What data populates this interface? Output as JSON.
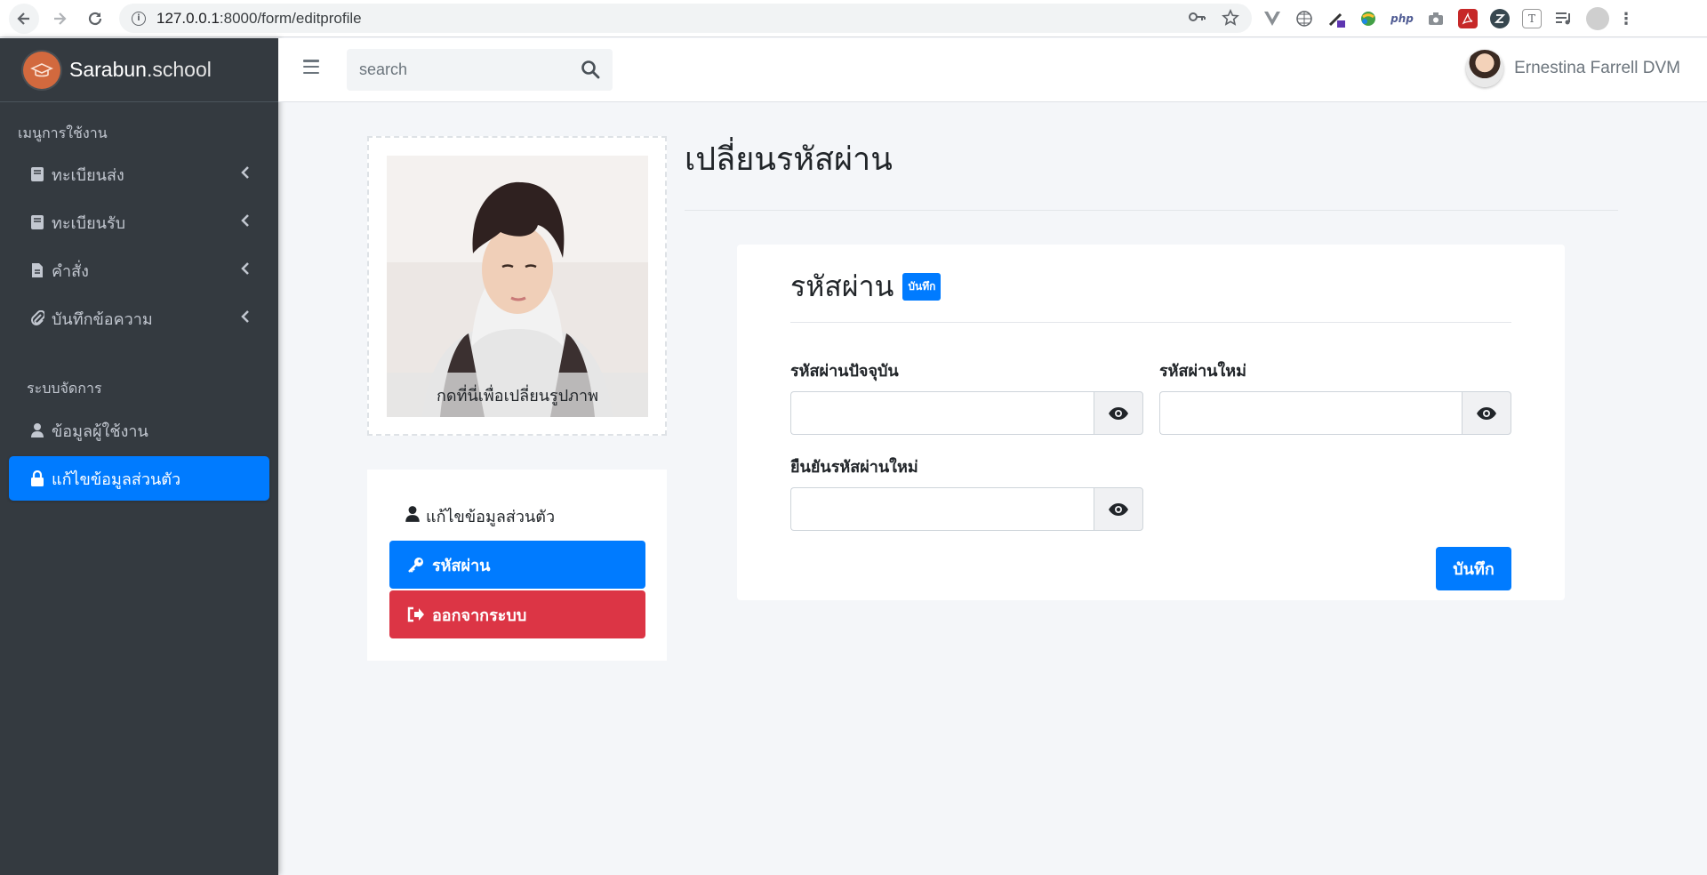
{
  "browser": {
    "url_host": "127.0.0.1",
    "url_rest": ":8000/form/editprofile",
    "icons": [
      "back-icon",
      "forward-icon",
      "reload-icon",
      "key-icon",
      "star-icon"
    ]
  },
  "brand": {
    "name_bold": "Sarabun",
    "name_rest": ".school",
    "logo_icon": "graduation-cap-icon",
    "logo_color": "#d2693e"
  },
  "sidebar": {
    "section1_header": "เมนูการใช้งาน",
    "section1_items": [
      {
        "label": "ทะเบียนส่ง",
        "icon": "book-icon"
      },
      {
        "label": "ทะเบียนรับ",
        "icon": "book-icon"
      },
      {
        "label": "คำสั่ง",
        "icon": "file-icon"
      },
      {
        "label": "บันทึกข้อความ",
        "icon": "paperclip-icon"
      }
    ],
    "section2_header": "ระบบจัดการ",
    "section2_items": [
      {
        "label": "ข้อมูลผู้ใช้งาน",
        "icon": "user-icon"
      },
      {
        "label": "แก้ไขข้อมูลส่วนตัว",
        "icon": "lock-icon",
        "active": true
      }
    ],
    "active_color": "#007bff"
  },
  "topbar": {
    "search_placeholder": "search",
    "user_name": "Ernestina Farrell DVM"
  },
  "profile": {
    "change_photo_caption": "กดที่นี่เพื่อเปลี่ยนรูปภาพ",
    "menu_title": "แก้ไขข้อมูลส่วนตัว",
    "password_button": "รหัสผ่าน",
    "logout_button": "ออกจากระบบ",
    "danger_color": "#dc3545"
  },
  "page": {
    "title": "เปลี่ยนรหัสผ่าน"
  },
  "form": {
    "heading": "รหัสผ่าน",
    "badge": "บันทึก",
    "current_password_label": "รหัสผ่านปัจจุบัน",
    "new_password_label": "รหัสผ่านใหม่",
    "confirm_password_label": "ยืนยันรหัสผ่านใหม่",
    "current_password_value": "",
    "new_password_value": "",
    "confirm_password_value": "",
    "save_button": "บันทึก"
  }
}
